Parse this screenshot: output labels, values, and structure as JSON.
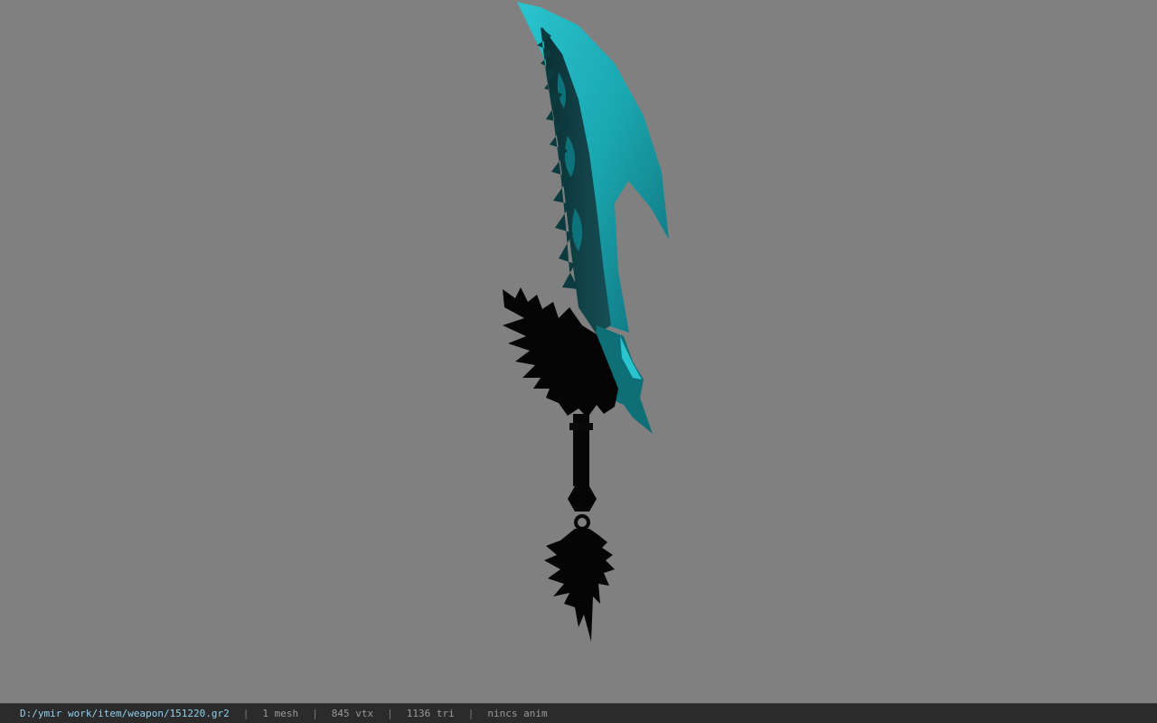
{
  "viewport": {
    "background_color": "#808080",
    "model": {
      "type": "weapon",
      "blade_color": "#1aa7b0",
      "shadow_color": "#050505"
    }
  },
  "statusbar": {
    "path": "D:/ymir work/item/weapon/151220.gr2",
    "meshes": "1 mesh",
    "vertices": "845 vtx",
    "triangles": "1136 tri",
    "animation": "nincs anim",
    "separator": "|"
  }
}
